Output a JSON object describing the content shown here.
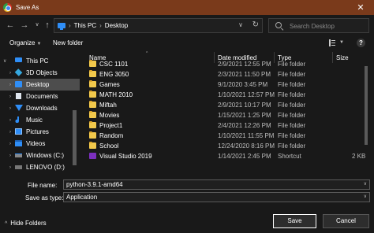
{
  "window": {
    "title": "Save As",
    "close_glyph": "✕"
  },
  "nav": {
    "back": "←",
    "forward": "→",
    "recent": "∨",
    "up": "↑",
    "breadcrumb": [
      "This PC",
      "Desktop"
    ],
    "breadcrumb_sep": "›",
    "dropdown": "∨",
    "refresh": "↻",
    "search_placeholder": "Search Desktop"
  },
  "toolbar": {
    "organize": "Organize",
    "organize_dd": "▼",
    "new_folder": "New folder",
    "view_dd": "▼",
    "help": "?"
  },
  "sidebar": {
    "items": [
      {
        "label": "This PC",
        "chev": "∨",
        "icon": "pc"
      },
      {
        "label": "3D Objects",
        "chev": "›",
        "icon": "3d"
      },
      {
        "label": "Desktop",
        "chev": "›",
        "icon": "desk",
        "selected": true
      },
      {
        "label": "Documents",
        "chev": "›",
        "icon": "docs"
      },
      {
        "label": "Downloads",
        "chev": "›",
        "icon": "down"
      },
      {
        "label": "Music",
        "chev": "›",
        "icon": "music"
      },
      {
        "label": "Pictures",
        "chev": "›",
        "icon": "pics"
      },
      {
        "label": "Videos",
        "chev": "›",
        "icon": "vids"
      },
      {
        "label": "Windows (C:)",
        "chev": "›",
        "icon": "drive"
      },
      {
        "label": "LENOVO (D:)",
        "chev": "›",
        "icon": "lenovo"
      }
    ]
  },
  "columns": {
    "name": "Name",
    "date": "Date modified",
    "type": "Type",
    "size": "Size",
    "sort_arrow": "^"
  },
  "files": [
    {
      "name": "CSC 1101",
      "date": "2/9/2021 12:55 PM",
      "type": "File folder",
      "size": "",
      "icon": "folder"
    },
    {
      "name": "ENG 3050",
      "date": "2/3/2021 11:50 PM",
      "type": "File folder",
      "size": "",
      "icon": "folder"
    },
    {
      "name": "Games",
      "date": "9/1/2020 3:45 PM",
      "type": "File folder",
      "size": "",
      "icon": "folder"
    },
    {
      "name": "MATH 2010",
      "date": "1/10/2021 12:57 PM",
      "type": "File folder",
      "size": "",
      "icon": "folder"
    },
    {
      "name": "Miftah",
      "date": "2/9/2021 10:17 PM",
      "type": "File folder",
      "size": "",
      "icon": "folder"
    },
    {
      "name": "Movies",
      "date": "1/15/2021 1:25 PM",
      "type": "File folder",
      "size": "",
      "icon": "folder"
    },
    {
      "name": "Project1",
      "date": "2/4/2021 12:26 PM",
      "type": "File folder",
      "size": "",
      "icon": "folder"
    },
    {
      "name": "Random",
      "date": "1/10/2021 11:55 PM",
      "type": "File folder",
      "size": "",
      "icon": "folder"
    },
    {
      "name": "School",
      "date": "12/24/2020 8:16 PM",
      "type": "File folder",
      "size": "",
      "icon": "folder"
    },
    {
      "name": "Visual Studio 2019",
      "date": "1/14/2021 2:45 PM",
      "type": "Shortcut",
      "size": "2 KB",
      "icon": "shortcut"
    }
  ],
  "form": {
    "file_name_label": "File name:",
    "file_name_value": "python-3.9.1-amd64",
    "save_type_label": "Save as type:",
    "save_type_value": "Application",
    "dd": "∨"
  },
  "footer": {
    "hide_folders": "Hide Folders",
    "hide_chev": "^",
    "save": "Save",
    "cancel": "Cancel"
  }
}
